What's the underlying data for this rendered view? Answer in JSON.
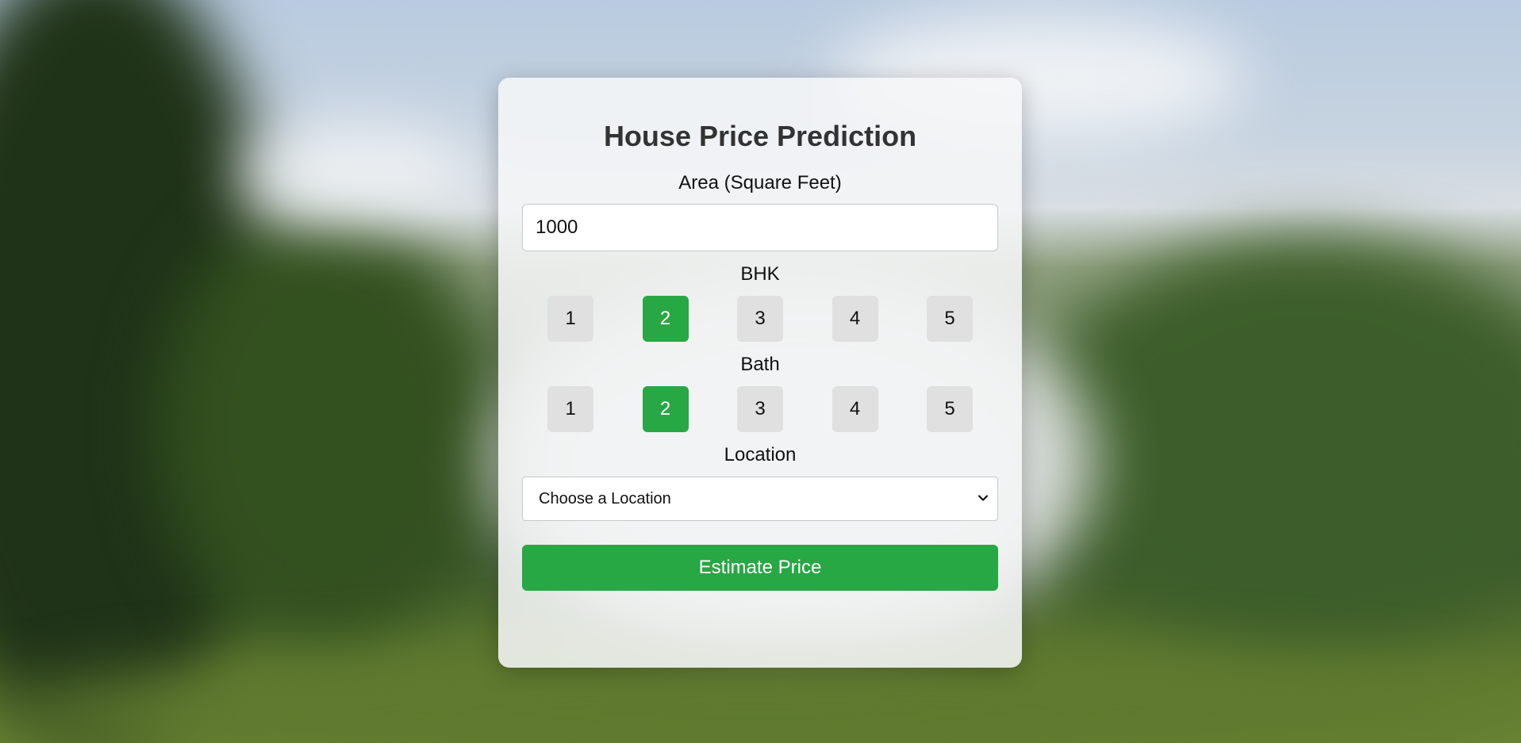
{
  "colors": {
    "accent": "#28a745",
    "option_bg": "#e0e0e0",
    "card_bg": "#f5f6f7",
    "title_text": "#333333"
  },
  "form": {
    "title": "House Price Prediction",
    "area": {
      "label": "Area (Square Feet)",
      "value": "1000"
    },
    "bhk": {
      "label": "BHK",
      "options": [
        "1",
        "2",
        "3",
        "4",
        "5"
      ],
      "selected": "2"
    },
    "bath": {
      "label": "Bath",
      "options": [
        "1",
        "2",
        "3",
        "4",
        "5"
      ],
      "selected": "2"
    },
    "location": {
      "label": "Location",
      "selected_text": "Choose a Location",
      "icon": "chevron-down-icon"
    },
    "submit_label": "Estimate Price"
  }
}
